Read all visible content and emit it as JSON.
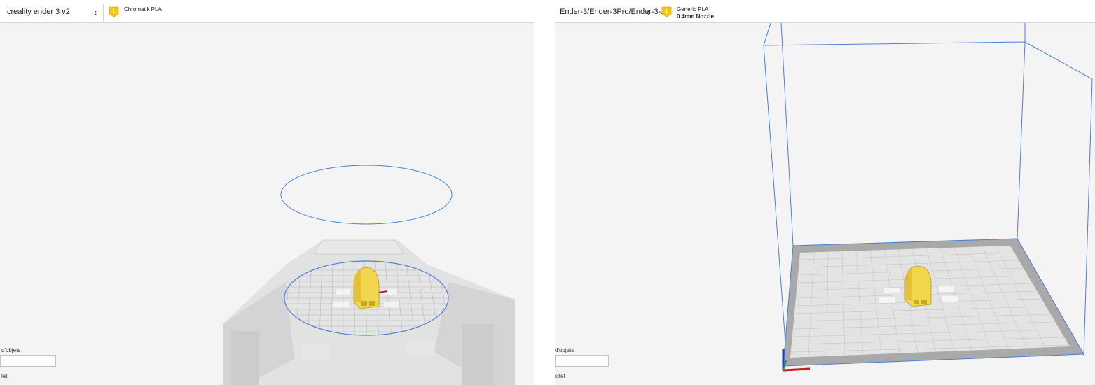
{
  "left_window": {
    "printer_name": "creality ender 3 v2",
    "material": "Chromatik PLA",
    "object_list_label": "d'objets",
    "bottom_label": "let"
  },
  "right_window": {
    "printer_name": "Ender-3/Ender-3Pro/Ender-3-...",
    "material": "Generic PLA",
    "nozzle": "0.4mm Nozzle",
    "object_list_label": "d'objets",
    "bottom_label": "sifet"
  },
  "icons": {
    "collapse": "chevron-left-icon",
    "extruder": "extruder-icon",
    "axes": "xyz-axes-icon"
  },
  "colors": {
    "material_yellow": "#f5c518",
    "build_volume_blue": "#4a7fd6",
    "model_yellow": "#f2d64b"
  }
}
